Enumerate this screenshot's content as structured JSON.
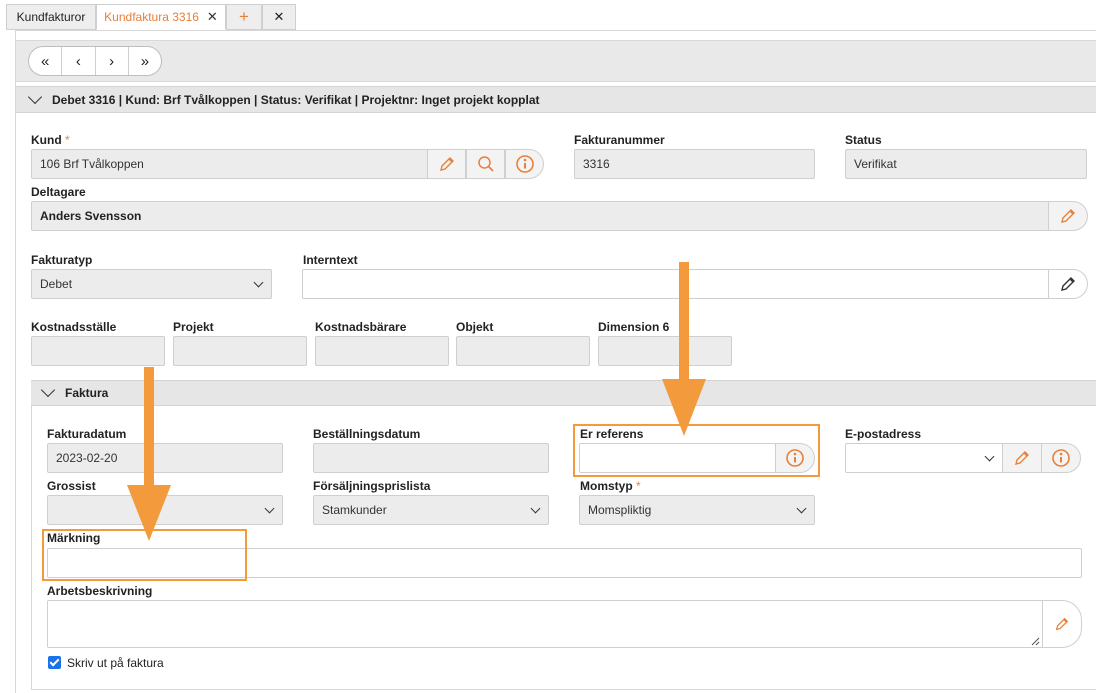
{
  "tabs": [
    {
      "label": "Kundfakturor"
    },
    {
      "label": "Kundfaktura 3316",
      "close": "✕"
    },
    {
      "label": "+"
    },
    {
      "label": "✕"
    }
  ],
  "nav": {
    "first": "«",
    "prev": "‹",
    "next": "›",
    "last": "»"
  },
  "header": {
    "title": "Debet 3316 | Kund: Brf Tvålkoppen | Status: Verifikat | Projektnr: Inget projekt kopplat"
  },
  "kund": {
    "label": "Kund",
    "required": "*",
    "value": "106 Brf Tvålkoppen"
  },
  "fakturanummer": {
    "label": "Fakturanummer",
    "value": "3316"
  },
  "status": {
    "label": "Status",
    "value": "Verifikat"
  },
  "deltagare": {
    "label": "Deltagare",
    "value": "Anders Svensson"
  },
  "fakturatyp": {
    "label": "Fakturatyp",
    "value": "Debet"
  },
  "internbext": {
    "label": "Interntext",
    "value": ""
  },
  "dimensions": [
    {
      "label": "Kostnadsställe",
      "value": ""
    },
    {
      "label": "Projekt",
      "value": ""
    },
    {
      "label": "Kostnadsbärare",
      "value": ""
    },
    {
      "label": "Objekt",
      "value": ""
    },
    {
      "label": "Dimension 6",
      "value": ""
    }
  ],
  "faktura_section": {
    "title": "Faktura"
  },
  "fakturadatum": {
    "label": "Fakturadatum",
    "value": "2023-02-20"
  },
  "bestallningsdatum": {
    "label": "Beställningsdatum",
    "value": ""
  },
  "er_referens": {
    "label": "Er referens",
    "value": ""
  },
  "epostadress": {
    "label": "E-postadress",
    "value": ""
  },
  "grossist": {
    "label": "Grossist",
    "value": ""
  },
  "forsaljningsprislista": {
    "label": "Försäljningsprislista",
    "value": "Stamkunder"
  },
  "momstyp": {
    "label": "Momstyp",
    "required": "*",
    "value": "Momspliktig"
  },
  "markning": {
    "label": "Märkning",
    "value": ""
  },
  "arbetsbeskrivning": {
    "label": "Arbetsbeskrivning",
    "value": ""
  },
  "skriv_ut": {
    "label": "Skriv ut på faktura",
    "checked": true
  },
  "colors": {
    "accent": "#e8803a",
    "annotation": "#f29a3c",
    "checkbox": "#1a73e8"
  }
}
